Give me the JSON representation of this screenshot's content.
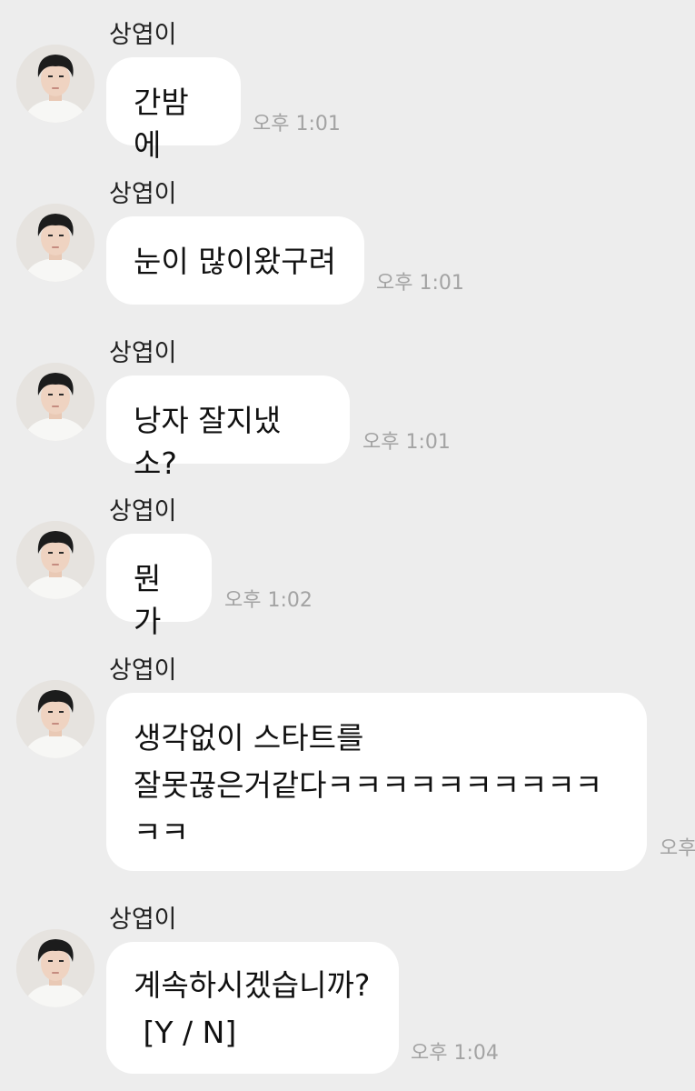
{
  "chat": {
    "messages": [
      {
        "sender": "상엽이",
        "text": "간밤에",
        "time": "오후 1:01"
      },
      {
        "sender": "상엽이",
        "text": "눈이 많이왔구려",
        "time": "오후 1:01"
      },
      {
        "sender": "상엽이",
        "text": "낭자 잘지냈소?",
        "time": "오후 1:01"
      },
      {
        "sender": "상엽이",
        "text": "뭔가",
        "time": "오후 1:02"
      },
      {
        "sender": "상엽이",
        "text": "생각없이 스타트를\n잘못끊은거같다ㅋㅋㅋㅋㅋㅋㅋㅋㅋㅋ\nㅋㅋ",
        "time": "오후"
      },
      {
        "sender": "상엽이",
        "text": "계속하시겠습니까?\n [Y / N]",
        "time": "오후 1:04"
      }
    ]
  },
  "colors": {
    "background": "#ededed",
    "bubble": "#ffffff",
    "timestamp": "#a3a3a3"
  },
  "icons": {
    "avatar": "profile-photo"
  }
}
